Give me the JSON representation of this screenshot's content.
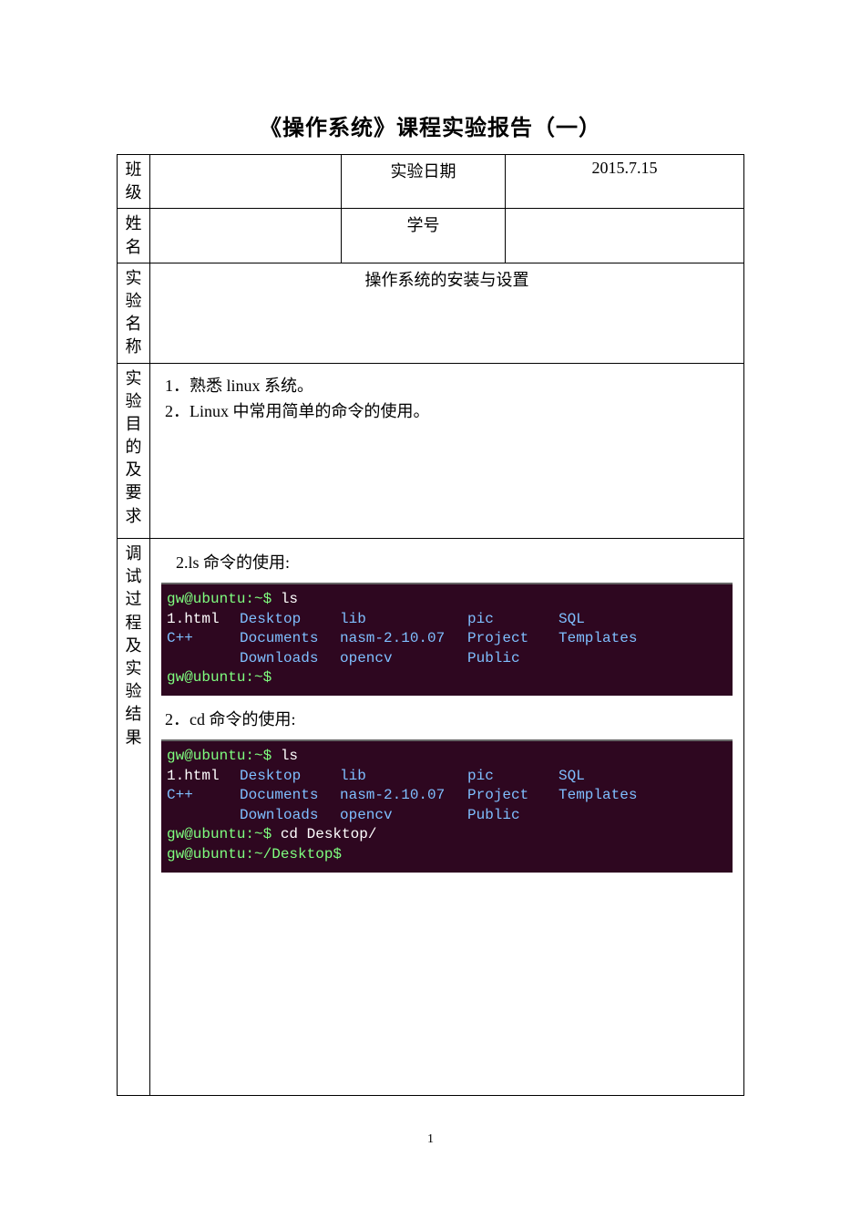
{
  "title": "《操作系统》课程实验报告（一）",
  "rows": {
    "class_label": "班级",
    "class_value": "",
    "date_label": "实验日期",
    "date_value": "2015.7.15",
    "name_label": "姓名",
    "name_value": "",
    "sid_label": "学号",
    "sid_value": "",
    "exp_name_label": "实验名称",
    "exp_name_value": "操作系统的安装与设置",
    "purpose_label": "实验目的及要求",
    "purpose_1": "1．熟悉 linux 系统。",
    "purpose_2": "2．Linux 中常用简单的命令的使用。",
    "debug_label": "调试过程及实验结果"
  },
  "debug": {
    "s1_title": "2.ls  命令的使用:",
    "s2_title": "2．cd   命令的使用:"
  },
  "term1": {
    "l1_prompt": "gw@ubuntu:~$",
    "l1_cmd": " ls",
    "row1": {
      "c1": "1.html",
      "c2": "Desktop",
      "c3": "lib",
      "c4": "pic",
      "c5": "SQL"
    },
    "row2": {
      "c1": "C++",
      "c2": "Documents",
      "c3": "nasm-2.10.07",
      "c4": "Project",
      "c5": "Templates"
    },
    "row3": {
      "c1": "",
      "c2": "Downloads",
      "c3": "opencv",
      "c4": "Public",
      "c5": ""
    },
    "l5_prompt": "gw@ubuntu:~$",
    "l5_cmd": " "
  },
  "term2": {
    "l1_prompt": "gw@ubuntu:~$",
    "l1_cmd": " ls",
    "row1": {
      "c1": "1.html",
      "c2": "Desktop",
      "c3": "lib",
      "c4": "pic",
      "c5": "SQL"
    },
    "row2": {
      "c1": "C++",
      "c2": "Documents",
      "c3": "nasm-2.10.07",
      "c4": "Project",
      "c5": "Templates"
    },
    "row3": {
      "c1": "",
      "c2": "Downloads",
      "c3": "opencv",
      "c4": "Public",
      "c5": ""
    },
    "l5_prompt": "gw@ubuntu:~$",
    "l5_cmd": " cd Desktop/",
    "l6_prompt": "gw@ubuntu:~/Desktop$",
    "l6_cmd": " "
  },
  "pagenum": "1"
}
